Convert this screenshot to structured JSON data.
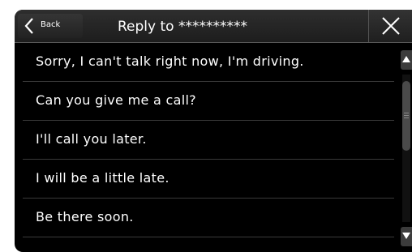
{
  "header": {
    "back_label": "Back",
    "title": "Reply to **********",
    "back_icon": "chevron-left-icon",
    "close_icon": "close-icon"
  },
  "messages": [
    "Sorry, I can't talk right now, I'm driving.",
    "Can you give me a call?",
    "I'll call you later.",
    "I will be a little late.",
    "Be there soon."
  ],
  "scrollbar": {
    "up_icon": "triangle-up-icon",
    "down_icon": "triangle-down-icon"
  },
  "colors": {
    "background": "#000000",
    "text": "#ffffff",
    "divider": "#3a3a3a",
    "header": "#262626"
  }
}
